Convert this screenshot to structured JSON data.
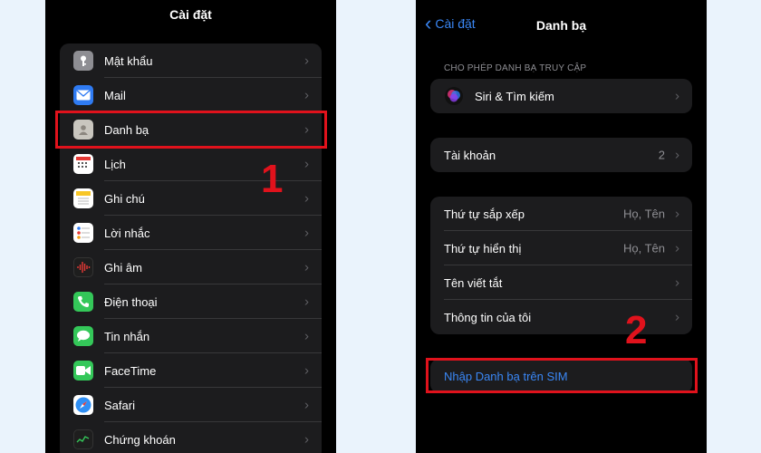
{
  "left": {
    "title": "Cài đặt",
    "items": [
      {
        "label": "Mật khẩu",
        "icon": "key-icon"
      },
      {
        "label": "Mail",
        "icon": "mail-icon"
      },
      {
        "label": "Danh bạ",
        "icon": "contacts-icon"
      },
      {
        "label": "Lịch",
        "icon": "calendar-icon"
      },
      {
        "label": "Ghi chú",
        "icon": "notes-icon"
      },
      {
        "label": "Lời nhắc",
        "icon": "reminders-icon"
      },
      {
        "label": "Ghi âm",
        "icon": "voice-memos-icon"
      },
      {
        "label": "Điện thoại",
        "icon": "phone-icon"
      },
      {
        "label": "Tin nhắn",
        "icon": "messages-icon"
      },
      {
        "label": "FaceTime",
        "icon": "facetime-icon"
      },
      {
        "label": "Safari",
        "icon": "safari-icon"
      },
      {
        "label": "Chứng khoán",
        "icon": "stocks-icon"
      }
    ],
    "step_number": "1"
  },
  "right": {
    "back_label": "Cài đặt",
    "title": "Danh bạ",
    "section_header": "CHO PHÉP DANH BẠ TRUY CẬP",
    "siri_label": "Siri & Tìm kiếm",
    "accounts_label": "Tài khoản",
    "accounts_value": "2",
    "sort_order_label": "Thứ tự sắp xếp",
    "sort_order_value": "Họ, Tên",
    "display_order_label": "Thứ tự hiển thị",
    "display_order_value": "Họ, Tên",
    "short_name_label": "Tên viết tắt",
    "my_info_label": "Thông tin của tôi",
    "import_sim_label": "Nhập Danh bạ trên SIM",
    "step_number": "2"
  },
  "colors": {
    "highlight": "#e0121c",
    "ios_blue": "#3a87f5",
    "cell_background": "#1c1c1e"
  }
}
